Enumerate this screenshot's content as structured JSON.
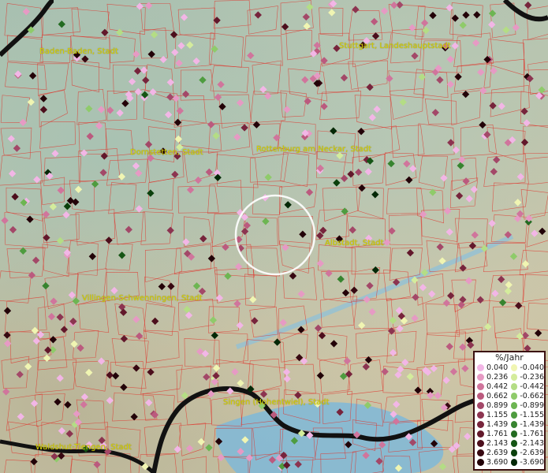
{
  "places": [
    {
      "name": "Baden-Baden, Stadt"
    },
    {
      "name": "Stuttgart, Landeshauptstadt"
    },
    {
      "name": "Dornstetten, Stadt"
    },
    {
      "name": "Rottenburg am Neckar, Stadt"
    },
    {
      "name": "Albstadt, Stadt"
    },
    {
      "name": "Villingen-Schwenningen, Stadt"
    },
    {
      "name": "Singen (Hohentwiel), Stadt"
    },
    {
      "name": "Waldshut-Tiengen, Stadt"
    }
  ],
  "legend": {
    "title": "%/Jahr",
    "positive": [
      {
        "value": "0.040",
        "color": "#f2b6e6"
      },
      {
        "value": "0.236",
        "color": "#e69ac4"
      },
      {
        "value": "0.442",
        "color": "#d0759c"
      },
      {
        "value": "0.662",
        "color": "#bb5a7e"
      },
      {
        "value": "0.899",
        "color": "#a34868"
      },
      {
        "value": "1.155",
        "color": "#8c3450"
      },
      {
        "value": "1.439",
        "color": "#77243c"
      },
      {
        "value": "1.761",
        "color": "#62182b"
      },
      {
        "value": "2.143",
        "color": "#4c0e1c"
      },
      {
        "value": "2.639",
        "color": "#370811"
      },
      {
        "value": "3.690",
        "color": "#220208"
      }
    ],
    "negative": [
      {
        "value": "-0.040",
        "color": "#f0f5b2"
      },
      {
        "value": "-0.236",
        "color": "#d4ec9c"
      },
      {
        "value": "-0.442",
        "color": "#b4dd85"
      },
      {
        "value": "-0.662",
        "color": "#8fcb6a"
      },
      {
        "value": "-0.899",
        "color": "#6db552"
      },
      {
        "value": "-1.155",
        "color": "#4e9c3f"
      },
      {
        "value": "-1.439",
        "color": "#37842f"
      },
      {
        "value": "-1.761",
        "color": "#236b21"
      },
      {
        "value": "-2.143",
        "color": "#155515"
      },
      {
        "value": "-2.639",
        "color": "#0b400c"
      },
      {
        "value": "-3.690",
        "color": "#042806"
      }
    ]
  },
  "colors": {
    "boundary": "#e0322a",
    "water": "#7fb9d8",
    "border": "#111111",
    "label": "#d8d200"
  }
}
